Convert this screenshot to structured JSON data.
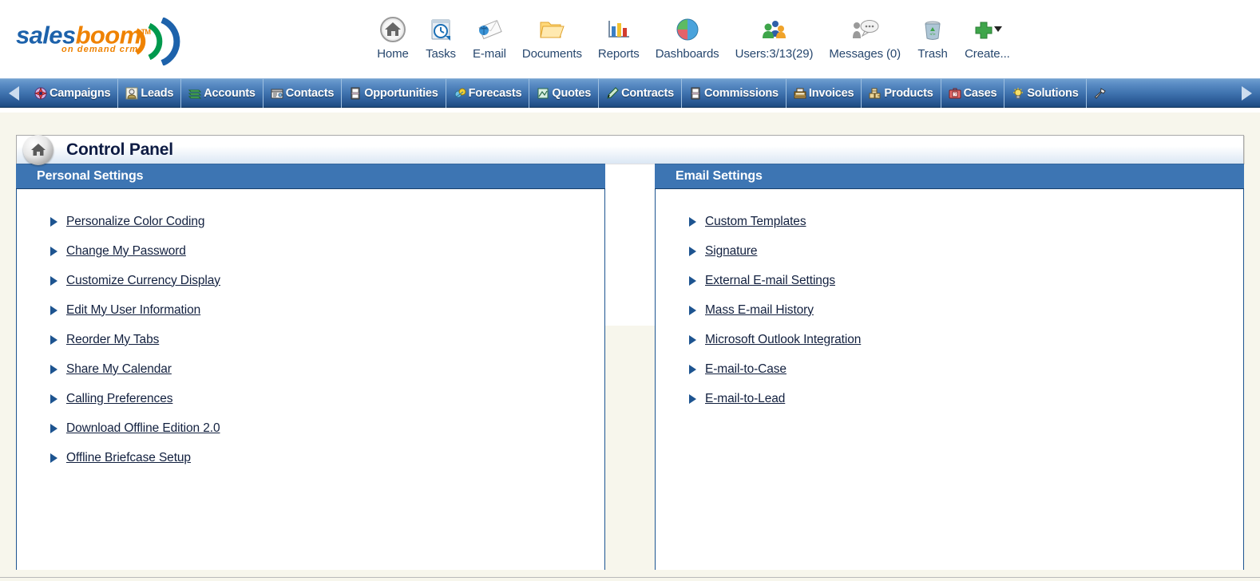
{
  "brand": {
    "name_part1": "sales",
    "name_part2": "boom",
    "tm": "TM",
    "tagline": "on demand crm"
  },
  "icon_nav": [
    {
      "label": "Home",
      "icon": "home-icon"
    },
    {
      "label": "Tasks",
      "icon": "clock-task-icon"
    },
    {
      "label": "E-mail",
      "icon": "envelope-globe-icon"
    },
    {
      "label": "Documents",
      "icon": "folder-icon"
    },
    {
      "label": "Reports",
      "icon": "bar-chart-icon"
    },
    {
      "label": "Dashboards",
      "icon": "pie-chart-icon"
    },
    {
      "label": "Users:3/13(29)",
      "icon": "users-group-icon"
    },
    {
      "label": "Messages (0)",
      "icon": "speech-bubble-icon"
    },
    {
      "label": "Trash",
      "icon": "recycle-bin-icon"
    },
    {
      "label": "Create...",
      "icon": "green-plus-dropdown-icon"
    }
  ],
  "tabs": {
    "scroll_left": "scroll-left-arrow",
    "scroll_right": "scroll-right-arrow",
    "items": [
      {
        "label": "Campaigns",
        "icon": "campaigns-icon"
      },
      {
        "label": "Leads",
        "icon": "leads-person-icon"
      },
      {
        "label": "Accounts",
        "icon": "accounts-stack-icon"
      },
      {
        "label": "Contacts",
        "icon": "contacts-card-icon"
      },
      {
        "label": "Opportunities",
        "icon": "opportunities-icon"
      },
      {
        "label": "Forecasts",
        "icon": "forecasts-icon"
      },
      {
        "label": "Quotes",
        "icon": "quotes-icon"
      },
      {
        "label": "Contracts",
        "icon": "contracts-pen-icon"
      },
      {
        "label": "Commissions",
        "icon": "commissions-icon"
      },
      {
        "label": "Invoices",
        "icon": "invoices-register-icon"
      },
      {
        "label": "Products",
        "icon": "products-boxes-icon"
      },
      {
        "label": "Cases",
        "icon": "cases-briefcase-icon"
      },
      {
        "label": "Solutions",
        "icon": "solutions-lightbulb-icon"
      },
      {
        "label": "",
        "icon": "tools-hammer-icon"
      }
    ]
  },
  "control_panel": {
    "title": "Control Panel",
    "home_icon": "home-icon"
  },
  "personal_settings": {
    "heading": "Personal Settings",
    "links": [
      "Personalize Color Coding",
      "Change My Password",
      "Customize Currency Display",
      "Edit My User Information",
      "Reorder My Tabs",
      "Share My Calendar",
      "Calling Preferences",
      "Download Offline Edition 2.0",
      "Offline Briefcase Setup"
    ]
  },
  "email_settings": {
    "heading": "Email Settings",
    "links": [
      "Custom Templates",
      "Signature",
      "External E-mail Settings",
      "Mass E-mail History",
      "Microsoft Outlook Integration",
      "E-mail-to-Case",
      "E-mail-to-Lead"
    ]
  },
  "colors": {
    "page_background": "#f7f6ec",
    "panel_header_blue": "#3d75b3",
    "panel_border": "#1d5490",
    "nav_gradient_top": "#6f9fd0",
    "nav_gradient_bottom": "#1d4b80",
    "link_text": "#12203f",
    "title_text": "#0d1b43",
    "brand_blue": "#1d62ab",
    "brand_orange": "#ef8200"
  }
}
